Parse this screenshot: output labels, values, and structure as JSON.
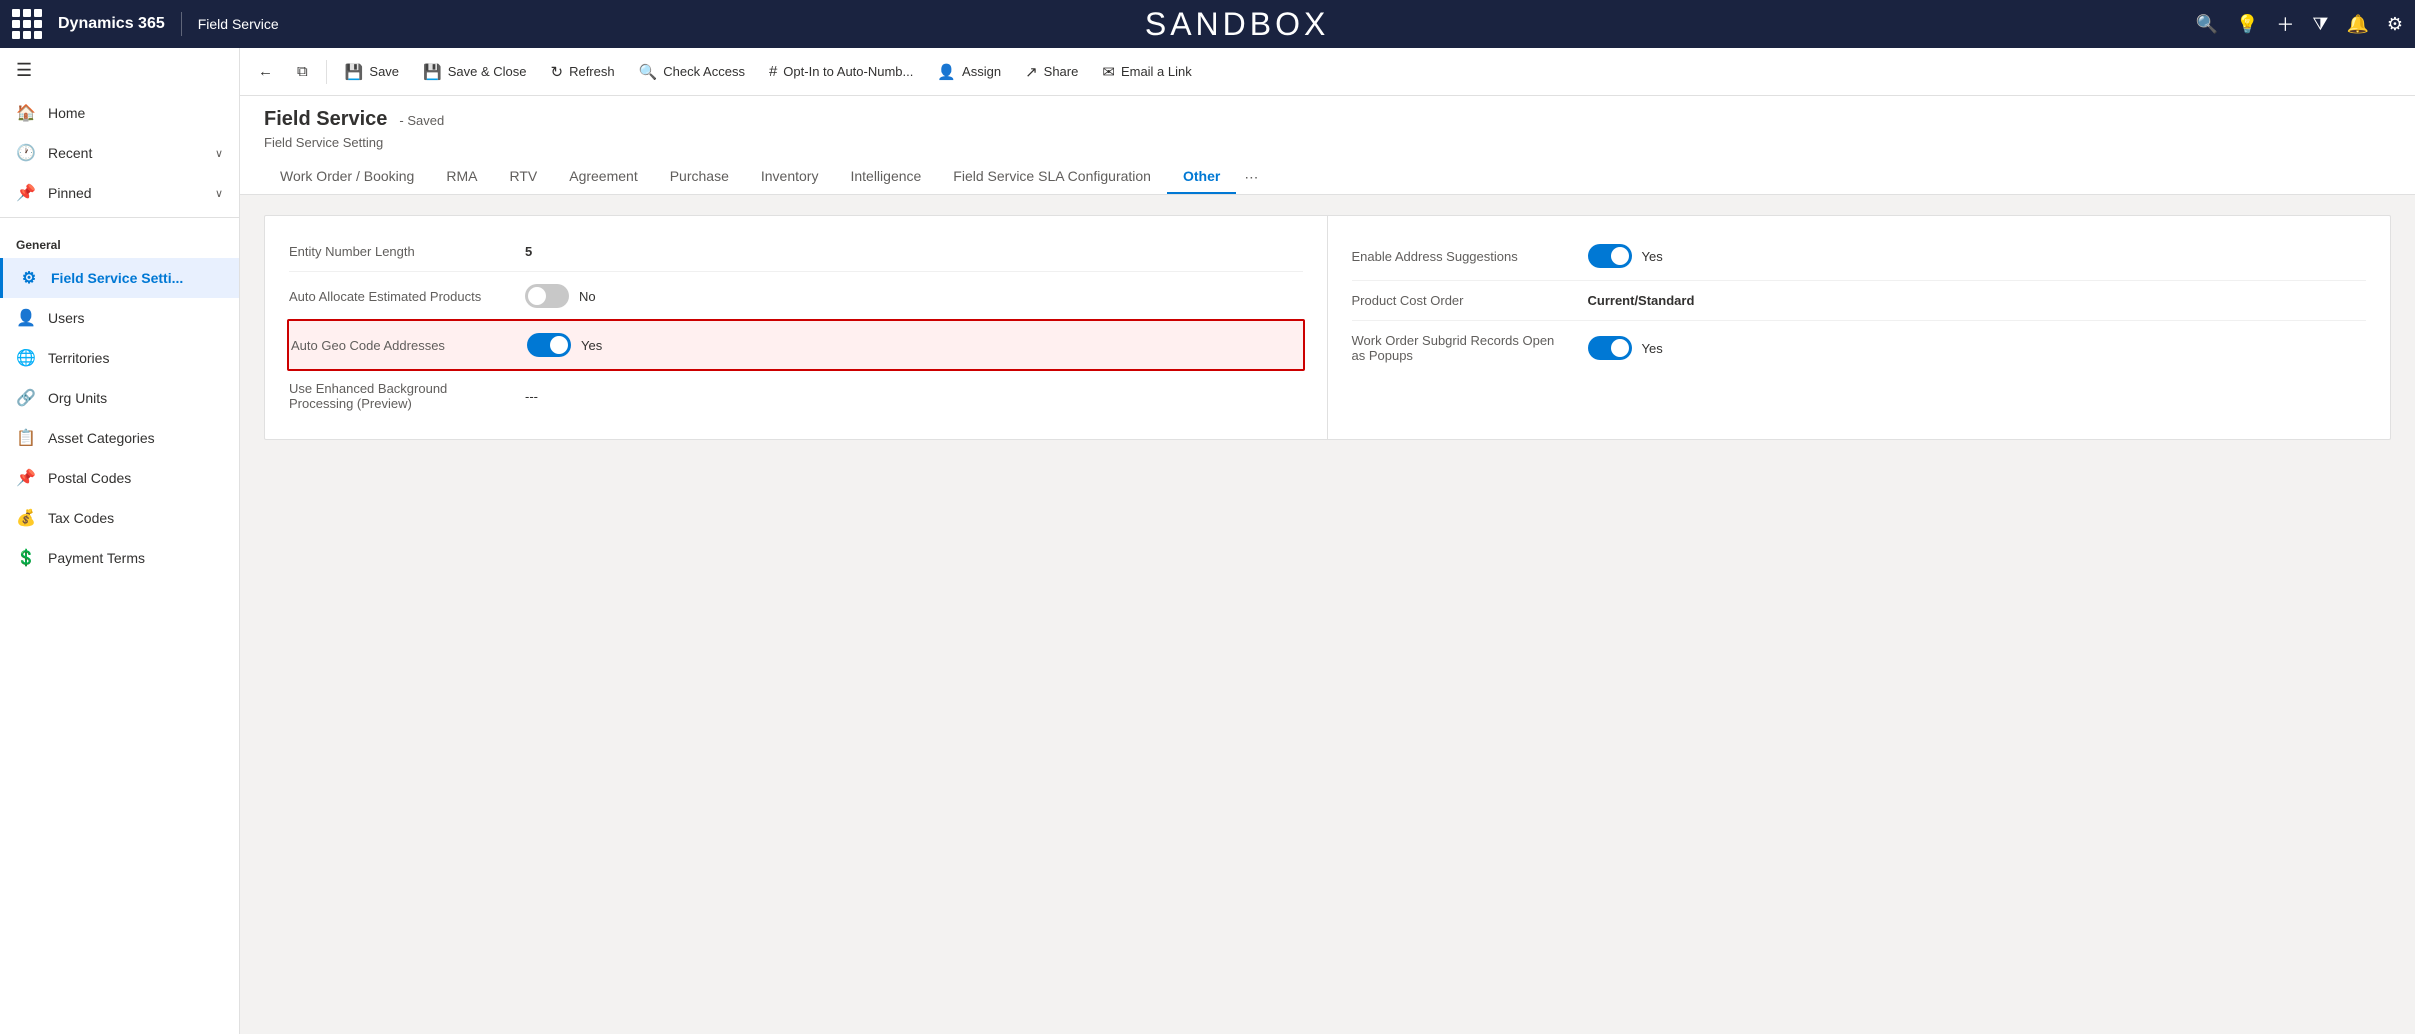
{
  "topNav": {
    "brand": "Dynamics 365",
    "divider": "|",
    "module": "Field Service",
    "sandboxTitle": "SANDBOX"
  },
  "commandBar": {
    "back": "←",
    "newWindow": "⧉",
    "save": "Save",
    "saveClose": "Save & Close",
    "refresh": "Refresh",
    "checkAccess": "Check Access",
    "optIn": "Opt-In to Auto-Numb...",
    "assign": "Assign",
    "share": "Share",
    "emailLink": "Email a Link"
  },
  "pageHeader": {
    "title": "Field Service",
    "savedLabel": "- Saved",
    "subtitle": "Field Service Setting"
  },
  "tabs": [
    {
      "id": "work-order-booking",
      "label": "Work Order / Booking",
      "active": false
    },
    {
      "id": "rma",
      "label": "RMA",
      "active": false
    },
    {
      "id": "rtv",
      "label": "RTV",
      "active": false
    },
    {
      "id": "agreement",
      "label": "Agreement",
      "active": false
    },
    {
      "id": "purchase",
      "label": "Purchase",
      "active": false
    },
    {
      "id": "inventory",
      "label": "Inventory",
      "active": false
    },
    {
      "id": "intelligence",
      "label": "Intelligence",
      "active": false
    },
    {
      "id": "field-service-sla",
      "label": "Field Service SLA Configuration",
      "active": false
    },
    {
      "id": "other",
      "label": "Other",
      "active": true
    }
  ],
  "leftColumn": {
    "rows": [
      {
        "id": "entity-number-length",
        "label": "Entity Number Length",
        "value": "5",
        "type": "text-bold",
        "highlighted": false
      },
      {
        "id": "auto-allocate",
        "label": "Auto Allocate Estimated Products",
        "value": "No",
        "toggleState": "off",
        "type": "toggle",
        "highlighted": false
      },
      {
        "id": "auto-geo-code",
        "label": "Auto Geo Code Addresses",
        "value": "Yes",
        "toggleState": "on",
        "type": "toggle",
        "highlighted": true
      },
      {
        "id": "enhanced-background",
        "label": "Use Enhanced Background Processing (Preview)",
        "value": "---",
        "type": "text",
        "highlighted": false
      }
    ]
  },
  "rightColumn": {
    "rows": [
      {
        "id": "enable-address-suggestions",
        "label": "Enable Address Suggestions",
        "value": "Yes",
        "toggleState": "on",
        "type": "toggle"
      },
      {
        "id": "product-cost-order",
        "label": "Product Cost Order",
        "value": "Current/Standard",
        "type": "text-bold"
      },
      {
        "id": "work-order-subgrid",
        "label": "Work Order Subgrid Records Open as Popups",
        "value": "Yes",
        "toggleState": "on",
        "type": "toggle"
      }
    ]
  },
  "sidebar": {
    "sections": [
      {
        "label": "General",
        "items": [
          {
            "id": "field-service-settings",
            "label": "Field Service Setti...",
            "icon": "⚙",
            "active": true
          },
          {
            "id": "users",
            "label": "Users",
            "icon": "👤",
            "active": false
          },
          {
            "id": "territories",
            "label": "Territories",
            "icon": "🌐",
            "active": false
          },
          {
            "id": "org-units",
            "label": "Org Units",
            "icon": "🔗",
            "active": false
          },
          {
            "id": "asset-categories",
            "label": "Asset Categories",
            "icon": "📋",
            "active": false
          },
          {
            "id": "postal-codes",
            "label": "Postal Codes",
            "icon": "📌",
            "active": false
          },
          {
            "id": "tax-codes",
            "label": "Tax Codes",
            "icon": "💰",
            "active": false
          },
          {
            "id": "payment-terms",
            "label": "Payment Terms",
            "icon": "💲",
            "active": false
          }
        ]
      }
    ],
    "navItems": [
      {
        "id": "home",
        "label": "Home",
        "icon": "🏠"
      },
      {
        "id": "recent",
        "label": "Recent",
        "icon": "🕐",
        "hasChevron": true
      },
      {
        "id": "pinned",
        "label": "Pinned",
        "icon": "📌",
        "hasChevron": true
      }
    ]
  }
}
